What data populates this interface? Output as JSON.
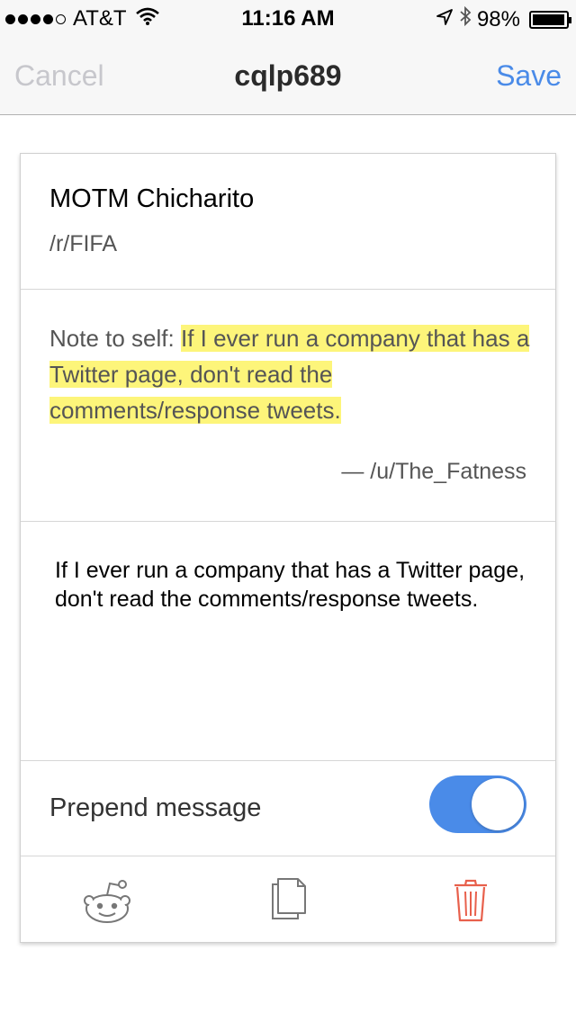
{
  "status_bar": {
    "carrier": "AT&T",
    "time": "11:16 AM",
    "battery": "98%",
    "battery_level": 0.98,
    "icons": [
      "signal-dots",
      "wifi-icon",
      "location-icon",
      "bluetooth-icon",
      "battery-icon"
    ]
  },
  "nav": {
    "cancel_label": "Cancel",
    "title": "cqlp689",
    "save_label": "Save"
  },
  "post": {
    "title": "MOTM Chicharito",
    "subreddit": "/r/FIFA"
  },
  "quote": {
    "prefix": "Note to self: ",
    "highlighted": "If I ever run a company that has a Twitter page, don't read the comments/response tweets.",
    "author": "— /u/The_Fatness"
  },
  "body": {
    "text": "If I ever run a company that has a Twitter page, don't read the comments/response tweets."
  },
  "toggle": {
    "label": "Prepend message",
    "on": true
  },
  "toolbar": {
    "icons": [
      "reddit-alien-icon",
      "copy-icon",
      "trash-icon"
    ]
  },
  "colors": {
    "accent": "#4a8be8",
    "highlight": "#fdf57a",
    "delete": "#e8604c",
    "muted": "#c7c7cc"
  }
}
